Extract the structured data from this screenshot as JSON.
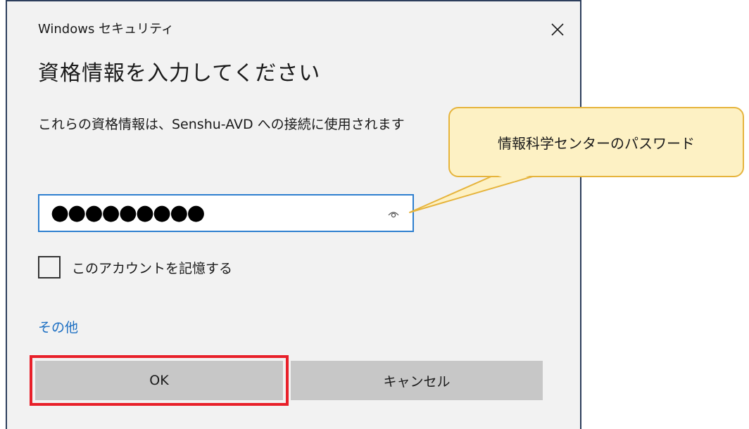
{
  "dialog": {
    "app_title": "Windows セキュリティ",
    "heading": "資格情報を入力してください",
    "description": "これらの資格情報は、Senshu-AVD への接続に使用されます",
    "password": {
      "value": "●●●●●●●●●",
      "masked": true
    },
    "remember_label": "このアカウントを記憶する",
    "remember_checked": false,
    "more_link": "その他",
    "ok_label": "OK",
    "cancel_label": "キャンセル"
  },
  "annotation": {
    "callout_text": "情報科学センターのパスワード",
    "highlight_color": "#e8202a",
    "callout_fill": "#fdf1c4",
    "callout_border": "#e6b43c"
  },
  "colors": {
    "accent": "#2e7fcf",
    "link": "#1b6ec2",
    "button_bg": "#c7c7c7",
    "dialog_bg": "#f2f2f2"
  }
}
